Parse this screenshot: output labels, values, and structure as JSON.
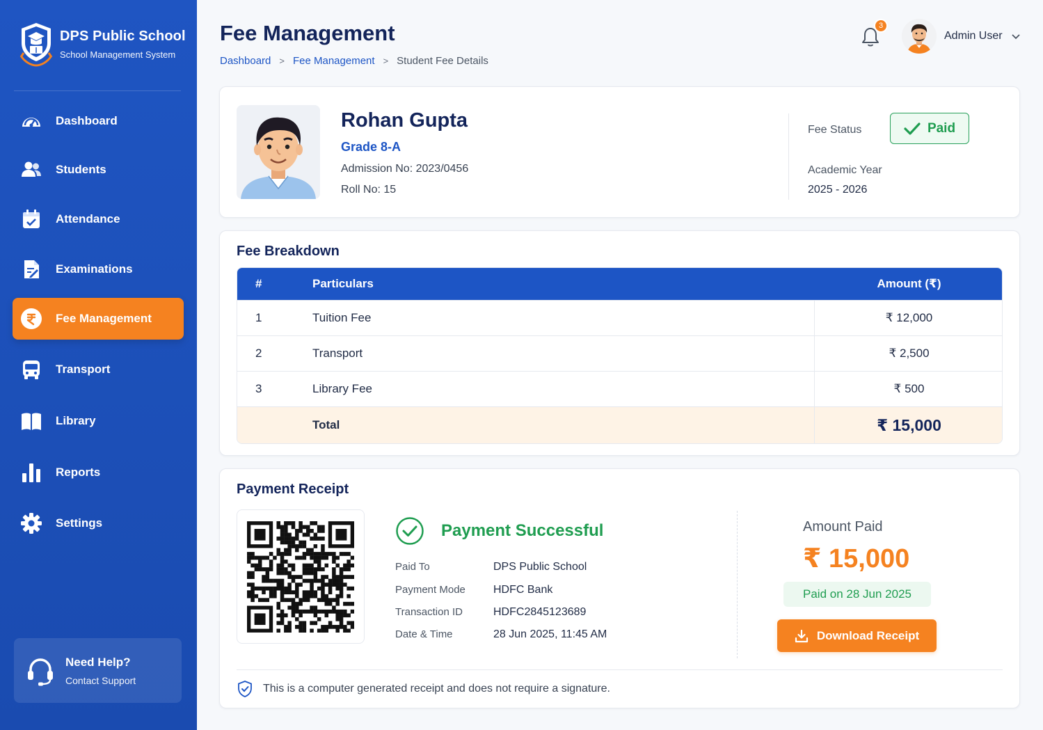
{
  "colors": {
    "primary": "#1d55c5",
    "accent": "#f58220",
    "success": "#1f9d50"
  },
  "brand": {
    "name": "DPS Public School",
    "subtitle": "School Management System",
    "logo_icon": "school-crest-icon"
  },
  "sidebar": {
    "items": [
      {
        "label": "Dashboard",
        "icon": "speedometer-icon"
      },
      {
        "label": "Students",
        "icon": "users-icon"
      },
      {
        "label": "Attendance",
        "icon": "calendar-check-icon"
      },
      {
        "label": "Examinations",
        "icon": "document-edit-icon"
      },
      {
        "label": "Fee Management",
        "icon": "rupee-icon",
        "active": true
      },
      {
        "label": "Transport",
        "icon": "bus-icon"
      },
      {
        "label": "Library",
        "icon": "book-icon"
      },
      {
        "label": "Reports",
        "icon": "bar-chart-icon"
      },
      {
        "label": "Settings",
        "icon": "gear-icon"
      }
    ],
    "help": {
      "title": "Need Help?",
      "subtitle": "Contact Support",
      "icon": "headset-icon"
    }
  },
  "header": {
    "title": "Fee Management",
    "breadcrumb": [
      "Dashboard",
      "Fee Management",
      "Student Fee Details"
    ],
    "notification_count": "3",
    "user_name": "Admin User"
  },
  "student": {
    "name": "Rohan Gupta",
    "grade": "Grade 8-A",
    "admission": "Admission No: 2023/0456",
    "roll": "Roll No: 15",
    "fee_status_label": "Fee Status",
    "fee_status": "Paid",
    "academic_year_label": "Academic Year",
    "academic_year": "2025 - 2026"
  },
  "fee_breakdown": {
    "title": "Fee Breakdown",
    "columns": [
      "#",
      "Particulars",
      "Amount (₹)"
    ],
    "rows": [
      {
        "num": "1",
        "particular": "Tuition Fee",
        "amount": "₹ 12,000"
      },
      {
        "num": "2",
        "particular": "Transport",
        "amount": "₹ 2,500"
      },
      {
        "num": "3",
        "particular": "Library Fee",
        "amount": "₹ 500"
      }
    ],
    "total_label": "Total",
    "total_amount": "₹ 15,000"
  },
  "receipt": {
    "title": "Payment Receipt",
    "status": "Payment Successful",
    "details": [
      {
        "label": "Paid To",
        "value": "DPS Public School"
      },
      {
        "label": "Payment Mode",
        "value": "HDFC Bank"
      },
      {
        "label": "Transaction ID",
        "value": "HDFC2845123689"
      },
      {
        "label": "Date & Time",
        "value": "28 Jun 2025, 11:45 AM"
      }
    ],
    "amount_label": "Amount Paid",
    "amount": "₹ 15,000",
    "paid_on": "Paid on 28 Jun 2025",
    "download_label": "Download Receipt",
    "note": "This is a computer generated receipt and does not require a signature."
  }
}
